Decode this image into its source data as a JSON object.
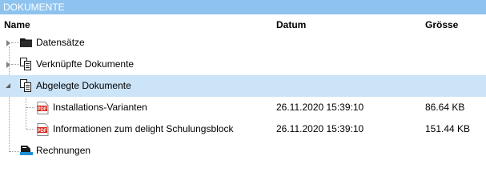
{
  "panel": {
    "title": "DOKUMENTE"
  },
  "columns": {
    "name": "Name",
    "date": "Datum",
    "size": "Grösse"
  },
  "tree": [
    {
      "label": "Datensätze",
      "icon": "folder-icon",
      "date": "",
      "size": ""
    },
    {
      "label": "Verknüpfte Dokumente",
      "icon": "linked-documents-icon",
      "date": "",
      "size": ""
    },
    {
      "label": "Abgelegte Dokumente",
      "icon": "linked-documents-icon",
      "date": "",
      "size": ""
    },
    {
      "label": "Installations-Varianten",
      "icon": "pdf-icon",
      "date": "26.11.2020 15:39:10",
      "size": "86.64 KB"
    },
    {
      "label": "Informationen zum delight Schulungsblock",
      "icon": "pdf-icon",
      "date": "26.11.2020 15:39:10",
      "size": "151.44 KB"
    },
    {
      "label": "Rechnungen",
      "icon": "invoices-icon",
      "date": "",
      "size": ""
    }
  ],
  "pdf_badge": "PDF",
  "colors": {
    "header_bg": "#8fc3ef",
    "selected_row": "#cce4f7",
    "pdf_red": "#d9251c"
  }
}
